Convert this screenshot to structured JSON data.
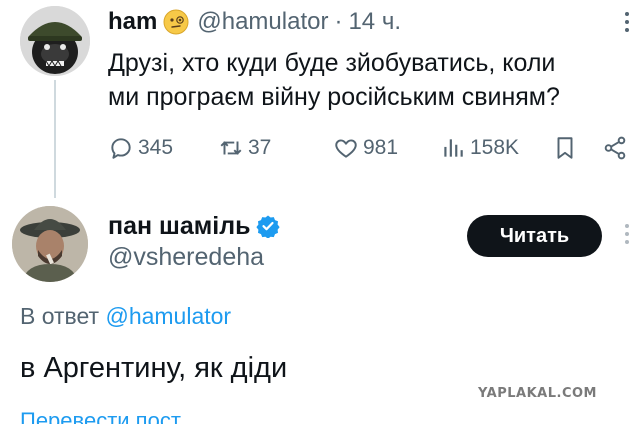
{
  "tweet": {
    "author_name": "ham",
    "author_handle": "@hamulator",
    "separator": "·",
    "time": "14 ч.",
    "text_lines": [
      "Друзі, хто куди буде зйобуватись, коли",
      "ми програєм війну російським свиням?"
    ],
    "stats": {
      "replies": "345",
      "reposts": "37",
      "likes": "981",
      "views": "158K"
    }
  },
  "reply": {
    "author_name": "пан шаміль",
    "author_handle": "@vsheredeha",
    "follow_label": "Читать",
    "reply_to_prefix": "В ответ",
    "reply_to_handle": "@hamulator",
    "text": "в Аргентину, як діди",
    "translate_label": "Перевести пост"
  },
  "watermark": "YAPLAKAL.COM",
  "colors": {
    "text": "#0f1419",
    "secondary": "#536471",
    "link": "#1d9bf0",
    "button": "#0f1419",
    "verified": "#1d9bf0"
  },
  "icons": [
    "reply-icon",
    "repost-icon",
    "like-icon",
    "views-icon",
    "bookmark-icon",
    "share-icon",
    "verified-badge-icon",
    "more-icon"
  ]
}
